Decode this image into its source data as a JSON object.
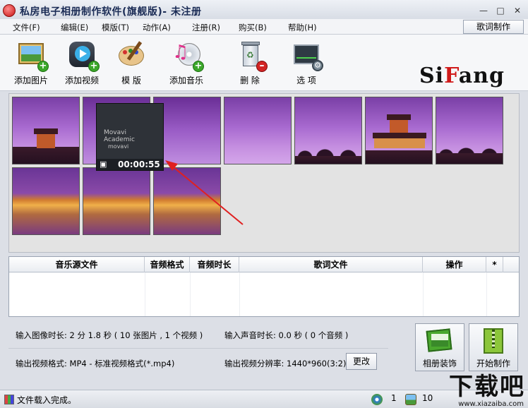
{
  "window": {
    "title": "私房电子相册制作软件(旗舰版)- 未注册",
    "controls": [
      "minimize-icon",
      "maximize-icon",
      "close-icon"
    ]
  },
  "menu": {
    "items": [
      "文件(F)",
      "编辑(E)",
      "模版(T)",
      "动作(A)",
      "注册(R)",
      "购买(B)",
      "帮助(H)"
    ],
    "lyric_button": "歌词制作"
  },
  "toolbar": {
    "items": [
      {
        "label": "添加图片",
        "icon": "add-picture-icon"
      },
      {
        "label": "添加视频",
        "icon": "add-video-icon"
      },
      {
        "label": "模 版",
        "icon": "palette-icon"
      },
      {
        "label": "添加音乐",
        "icon": "add-music-icon"
      },
      {
        "label": "删 除",
        "icon": "recycle-bin-icon"
      },
      {
        "label": "选 项",
        "icon": "options-icon"
      }
    ],
    "logo": {
      "part1": "Si",
      "part2": "F",
      "part3": "ang"
    }
  },
  "video_tooltip": {
    "watermark_line1": "Movavi Academic",
    "watermark_line2": "movavi",
    "duration": "00:00:55"
  },
  "music_table": {
    "columns": [
      "音乐源文件",
      "音频格式",
      "音频时长",
      "歌词文件",
      "操作",
      "*"
    ]
  },
  "info": {
    "input_image_duration_label": "输入图像时长:",
    "input_image_duration_value": "2 分 1.8 秒 ( 10 张图片 , 1 个视频 )",
    "input_audio_duration_label": "输入声音时长:",
    "input_audio_duration_value": "0.0 秒 ( 0 个音频 )",
    "output_format_label": "输出视频格式:",
    "output_format_value": "MP4 - 标准视频格式(*.mp4)",
    "output_resolution_label": "输出视频分辨率:",
    "output_resolution_value": "1440*960(3:2)",
    "change_button": "更改",
    "decorate_button": "相册装饰",
    "start_button": "开始制作"
  },
  "status": {
    "text": "文件载入完成。",
    "count1": "1",
    "count2": "10"
  },
  "site_watermark": {
    "big": "下载吧",
    "small": "www.xiazaiba.com"
  },
  "colors": {
    "accent_red": "#d01a1a",
    "title_text": "#1a2b55",
    "plus_green": "#3ba72a"
  }
}
